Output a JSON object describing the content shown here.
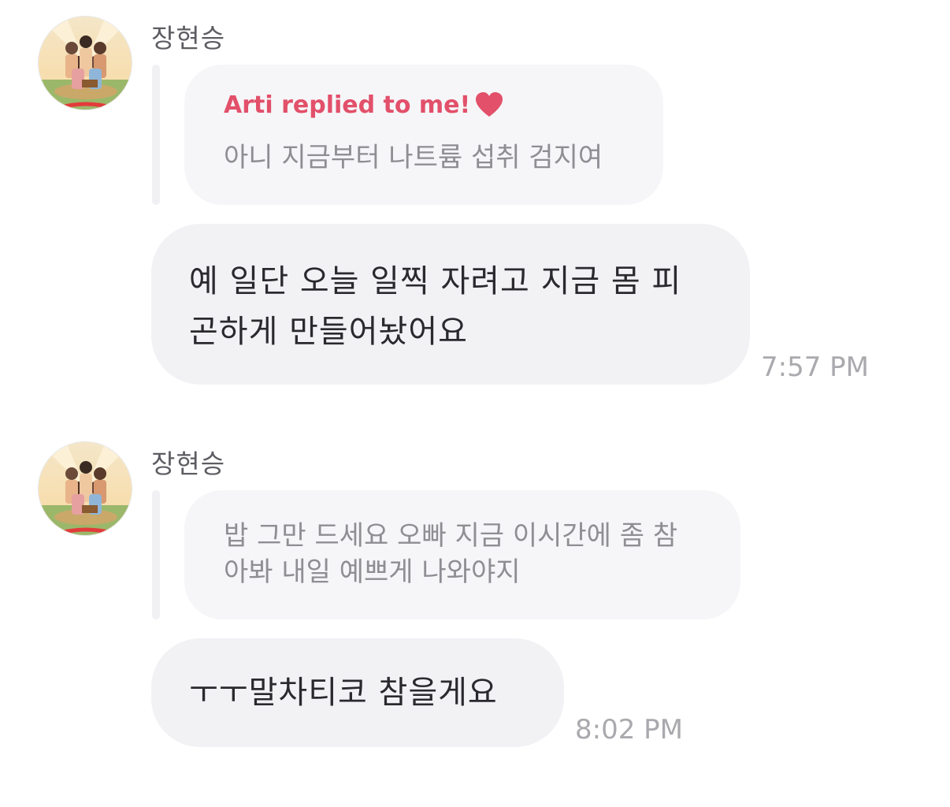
{
  "messages": [
    {
      "sender": "장현승",
      "reply": {
        "header": "Arti replied to me!",
        "text": "아니 지금부터 나트륨 섭취 검지여"
      },
      "lines": [
        "예 일단 오늘 일찍 자려고 지금 몸 피",
        "곤하게 만들어놨어요"
      ],
      "time": "7:57 PM"
    },
    {
      "sender": "장현승",
      "reply": {
        "lines": [
          "밥 그만 드세요 오빠 지금 이시간에 좀 참",
          "아봐 내일 예쁘게 나와야지"
        ]
      },
      "lines": [
        "ㅜㅜ말차티코 참을게요"
      ],
      "time": "8:02 PM"
    }
  ],
  "icons": {
    "avatar": "group-photo-avatar",
    "heart": "heart-icon"
  },
  "colors": {
    "accent": "#e2506a",
    "bubble": "#f2f2f5",
    "quote": "#f6f6f8",
    "timestamp": "#a9a9ae"
  }
}
